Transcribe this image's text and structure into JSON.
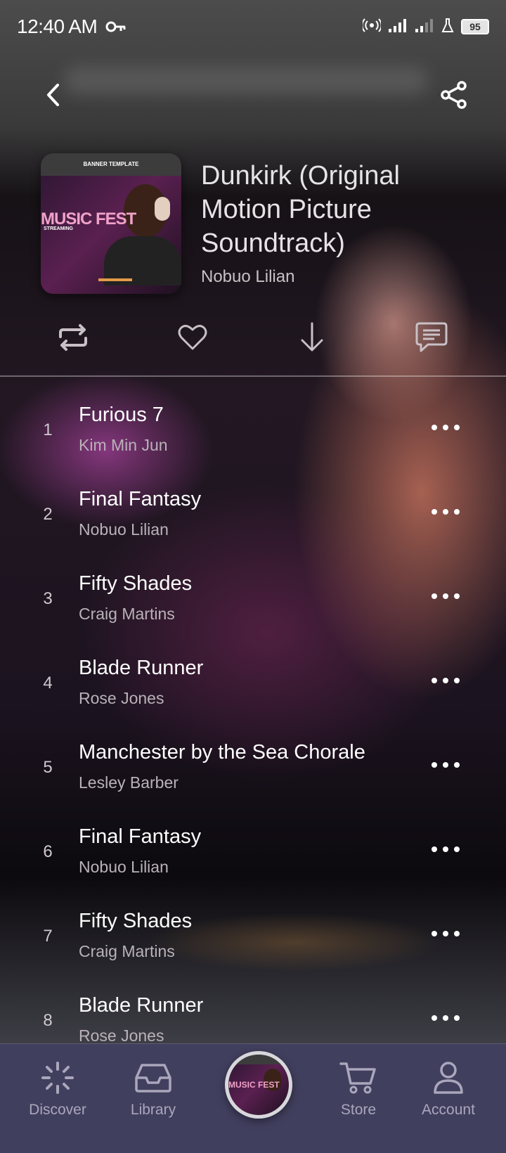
{
  "status_bar": {
    "time": "12:40 AM",
    "battery": "95"
  },
  "album": {
    "title": "Dunkirk (Original Motion Picture Soundtrack)",
    "artist": "Nobuo Lilian",
    "art_text": {
      "banner": "BANNER TEMPLATE",
      "headline": "MUSIC FEST",
      "sub": "STREAMING"
    }
  },
  "actions": [
    "repeat-icon",
    "heart-icon",
    "download-icon",
    "comment-icon"
  ],
  "tracks": [
    {
      "num": "1",
      "title": "Furious 7",
      "artist": "Kim Min Jun"
    },
    {
      "num": "2",
      "title": "Final Fantasy",
      "artist": "Nobuo Lilian"
    },
    {
      "num": "3",
      "title": "Fifty Shades",
      "artist": "Craig Martins"
    },
    {
      "num": "4",
      "title": "Blade Runner",
      "artist": "Rose Jones"
    },
    {
      "num": "5",
      "title": "Manchester by the Sea Chorale",
      "artist": "Lesley Barber"
    },
    {
      "num": "6",
      "title": "Final Fantasy",
      "artist": "Nobuo Lilian"
    },
    {
      "num": "7",
      "title": "Fifty Shades",
      "artist": "Craig Martins"
    },
    {
      "num": "8",
      "title": "Blade Runner",
      "artist": "Rose Jones"
    }
  ],
  "nav": {
    "discover": "Discover",
    "library": "Library",
    "store": "Store",
    "account": "Account"
  },
  "colors": {
    "nav_bg": "#413f5e",
    "accent_pink": "#f0a2c8"
  }
}
